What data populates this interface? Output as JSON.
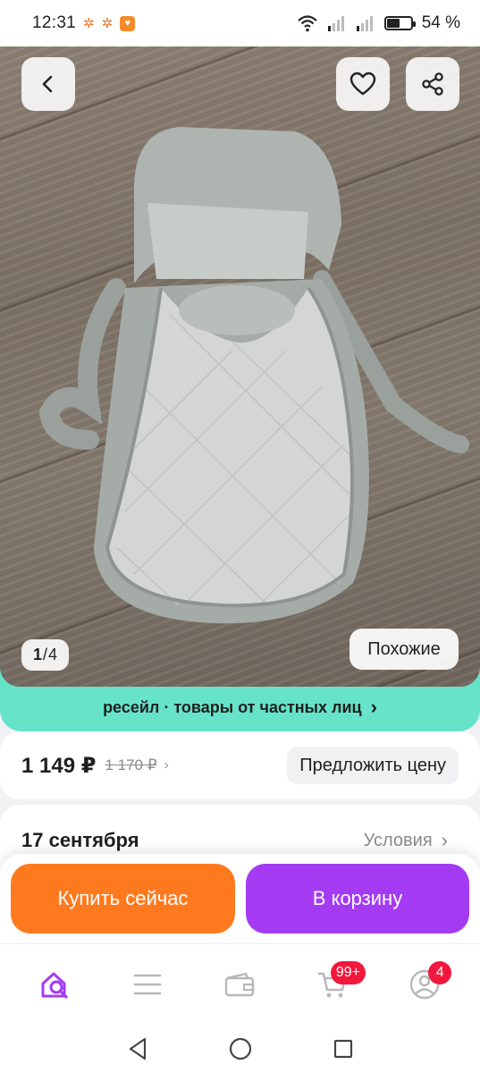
{
  "status_bar": {
    "time": "12:31",
    "battery_percent": "54 %",
    "battery_level": 0.54
  },
  "gallery": {
    "current": "1",
    "separator": "/",
    "total": "4",
    "similar_label": "Похожие"
  },
  "resale_banner": {
    "text": "ресейл · товары от частных лиц",
    "arrow": "›"
  },
  "price": {
    "current": "1 149 ₽",
    "old": "1 170 ₽",
    "offer_label": "Предложить цену"
  },
  "delivery": {
    "date": "17 сентября",
    "conditions_label": "Условия"
  },
  "actions": {
    "buy_now_label": "Купить сейчас",
    "buy_now_color": "#ff7a1f",
    "add_to_cart_label": "В корзину",
    "add_to_cart_color": "#a43bf3"
  },
  "bottom_nav": {
    "items": [
      {
        "icon": "home-search-icon",
        "active": true
      },
      {
        "icon": "catalog-menu-icon"
      },
      {
        "icon": "wallet-icon"
      },
      {
        "icon": "cart-icon",
        "badge": "99+"
      },
      {
        "icon": "profile-icon",
        "badge": "4"
      }
    ]
  },
  "colors": {
    "accent": "#a43bf3",
    "resale": "#66e3c9",
    "badge": "#f0183c"
  }
}
